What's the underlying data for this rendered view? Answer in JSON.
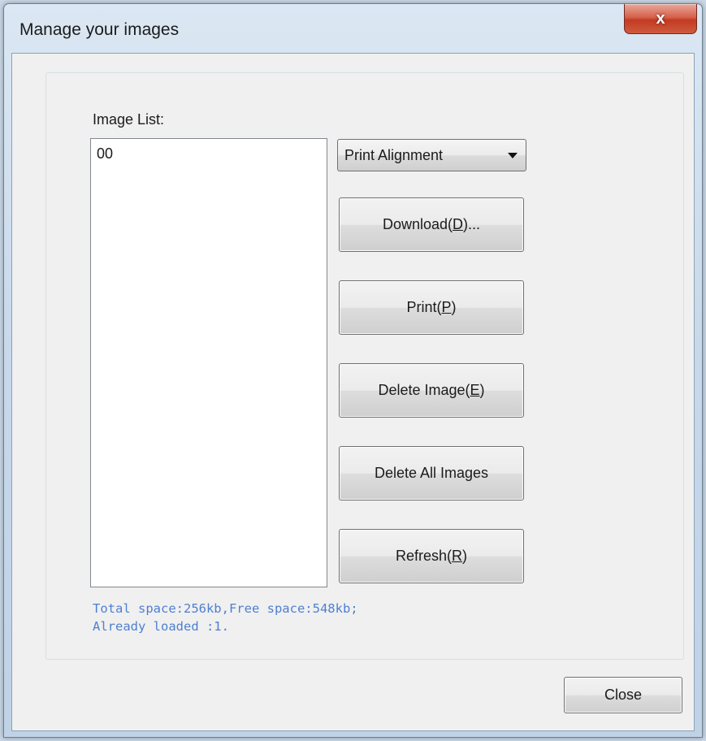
{
  "window": {
    "title": "Manage your images",
    "close_glyph": "x"
  },
  "image_list": {
    "label": "Image List:",
    "items": [
      "00"
    ]
  },
  "alignment_select": {
    "selected": "Print Alignment"
  },
  "buttons": {
    "download": {
      "text": "Download(",
      "key": "D",
      "after": ")..."
    },
    "print": {
      "text": "Print(",
      "key": "P",
      "after": ")"
    },
    "delete_image": {
      "text": "Delete Image(",
      "key": "E",
      "after": ")"
    },
    "delete_all": {
      "text": "Delete All Images",
      "key": "",
      "after": ""
    },
    "refresh": {
      "text": "Refresh(",
      "key": "R",
      "after": ")"
    },
    "close": "Close"
  },
  "status": {
    "line1": "Total space:256kb,Free space:548kb;",
    "line2": "Already loaded :1."
  },
  "colors": {
    "status_text": "#4f7fd0",
    "close_x_red": "#c23b22"
  }
}
